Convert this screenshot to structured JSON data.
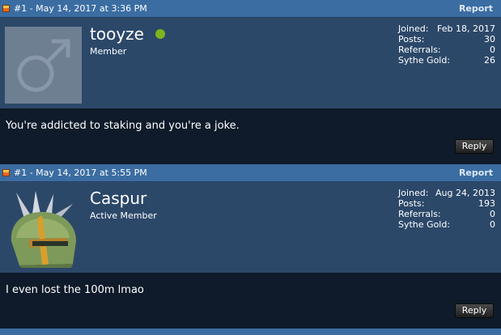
{
  "posts": [
    {
      "post_info": "#1 - May 14, 2017 at 3:36 PM",
      "report_label": "Report",
      "username": "tooyze",
      "rank": "Member",
      "stats": [
        {
          "label": "Joined:",
          "value": "Feb 18, 2017"
        },
        {
          "label": "Posts:",
          "value": "30"
        },
        {
          "label": "Referrals:",
          "value": "0"
        },
        {
          "label": "Sythe Gold:",
          "value": "26"
        }
      ],
      "message": "You're addicted to staking and you're a joke.",
      "reply_label": "Reply"
    },
    {
      "post_info": "#1 - May 14, 2017 at 5:55 PM",
      "report_label": "Report",
      "username": "Caspur",
      "rank": "Active Member",
      "stats": [
        {
          "label": "Joined:",
          "value": "Aug 24, 2013"
        },
        {
          "label": "Posts:",
          "value": "193"
        },
        {
          "label": "Referrals:",
          "value": "0"
        },
        {
          "label": "Sythe Gold:",
          "value": "0"
        }
      ],
      "message": "I even lost the 100m lmao",
      "reply_label": "Reply"
    }
  ],
  "colors": {
    "header": "#3b6da2",
    "user_block": "#2c4869",
    "message_bg": "#0f1b2a",
    "online": "#7db41c"
  },
  "icons": {
    "post_icon": "post-icon",
    "default_avatar": "male-symbol-icon",
    "online": "online-status-icon"
  }
}
